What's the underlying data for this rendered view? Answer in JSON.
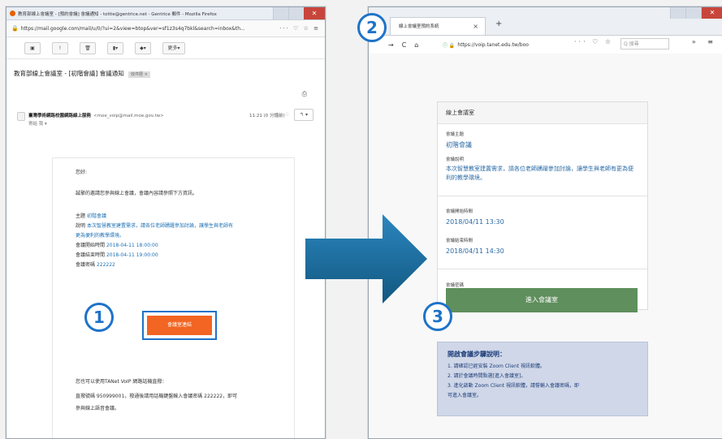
{
  "left_window": {
    "title": "教育部線上會議室 - [預約會議] 會議通知 - tottie@gentrice.net - Gentrice 郵件 - Mozilla Firefox",
    "url": "https://mail.google.com/mail/u/0/?ui=2&view=btop&ver=sf1z3s4q7bkl&search=inbox&th...",
    "url_tools": "··· ♡ ☆ ≡",
    "toolbar_more": "更多",
    "subject": "教育部線上會議室 - [初階會議] 會議通知",
    "subject_tag": "收件匣 ×",
    "sender_name": "臺灣學術網路校園網路線上服務",
    "sender_email": "<moe_voip@mail.moe.gov.tw>",
    "sender_to": "寄給 我 ▾",
    "sender_time": "11:21 (0 分鐘前)",
    "body": {
      "greeting": "您好:",
      "intro": "誠摯的邀請您參與線上會議，會議內容請參照下方資訊。",
      "topic_label": "主題",
      "topic_value": "初階會議",
      "desc_label": "說明",
      "desc_value_1": "本次智慧教室建置需求，請各位老師踴躍參加討論，讓學生與老師有",
      "desc_value_2": "更為便利的教學環境。",
      "start_label": "會議開始時間",
      "start_value": "2018-04-11 18:00:00",
      "end_label": "會議結束時間",
      "end_value": "2018-04-11 19:00:00",
      "pw_label": "會議密碼",
      "pw_value": "222222",
      "button_label": "會議室連結",
      "footer_1": "您也可以使用TANet VoIP 網路話機直撥：",
      "footer_2": "直撥號碼 950999001，撥通後請用話機鍵盤輸入會議密碼 222222，即可",
      "footer_3": "參與線上語音會議。"
    }
  },
  "right_window": {
    "tab_title": "線上會議室預約系統",
    "url": "https://voip.tanet.edu.tw/boo",
    "search_placeholder": "Q 搜尋",
    "card": {
      "header": "線上會議室",
      "topic_label": "會議主題",
      "topic_value": "初階會議",
      "desc_label": "會議說明",
      "desc_value": "本次智慧教室建置需求，請各位老師踴躍參加討論，讓學生與老師有更為便利的教學環境。",
      "start_label": "會議開始時間",
      "start_value": "2018/04/11 13:30",
      "end_label": "會議結束時間",
      "end_value": "2018/04/11 14:30",
      "pw_label": "會議密碼",
      "enter_button": "進入會議室"
    },
    "steps": {
      "title": "開啟會議步驟說明：",
      "step1": "1. 請確認已經安裝 Zoom Client 視訊軟體。",
      "step2": "2. 請於會議時間點選[進入會議室]。",
      "step3a": "3. 進化啟動 Zoom Client 視訊軟體，請誓輸入會議密碼，即",
      "step3b": "可進入會議室。"
    }
  },
  "badges": [
    "1",
    "2",
    "3"
  ],
  "colors": {
    "accent_blue": "#1e73c8",
    "arrow_blue": "#1a6b9c",
    "orange_button": "#f26522",
    "green_button": "#5f8f5c",
    "link_blue": "#1a6fb3"
  }
}
